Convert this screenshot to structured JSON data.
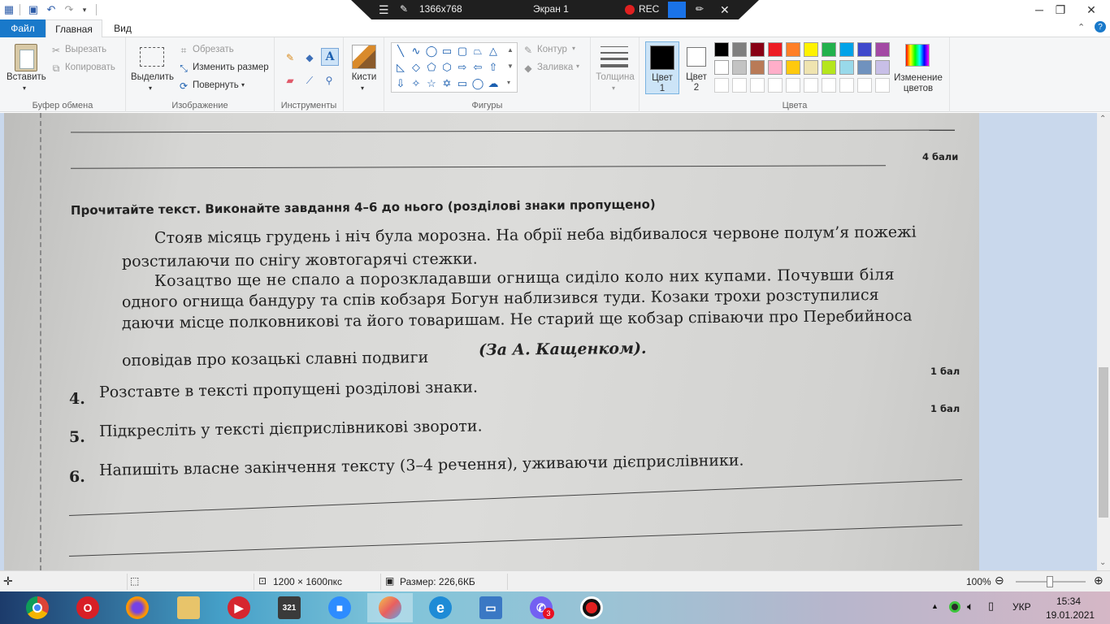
{
  "titlebar": {
    "recorder": {
      "resolution": "1366x768",
      "screen": "Экран 1",
      "rec": "REC"
    }
  },
  "menu": {
    "file": "Файл",
    "home": "Главная",
    "view": "Вид"
  },
  "ribbon": {
    "clipboard": {
      "paste": "Вставить",
      "cut": "Вырезать",
      "copy": "Копировать",
      "label": "Буфер обмена"
    },
    "image": {
      "select": "Выделить",
      "crop": "Обрезать",
      "resize": "Изменить размер",
      "rotate": "Повернуть",
      "label": "Изображение"
    },
    "tools": {
      "label": "Инструменты"
    },
    "brushes": {
      "label": "Кисти"
    },
    "shapes": {
      "outline": "Контур",
      "fill": "Заливка",
      "label": "Фигуры"
    },
    "size": {
      "label": "Толщина"
    },
    "colors": {
      "color1_line1": "Цвет",
      "color1_line2": "1",
      "color2_line1": "Цвет",
      "color2_line2": "2",
      "edit_line1": "Изменение",
      "edit_line2": "цветов",
      "label": "Цвета",
      "palette_row1": [
        "#000000",
        "#7f7f7f",
        "#880015",
        "#ed1c24",
        "#ff7f27",
        "#fff200",
        "#22b14c",
        "#00a2e8",
        "#3f48cc",
        "#a349a4"
      ],
      "palette_row2": [
        "#ffffff",
        "#c3c3c3",
        "#b97a57",
        "#ffaec9",
        "#ffc90e",
        "#efe4b0",
        "#b5e61d",
        "#99d9ea",
        "#7092be",
        "#c8bfe7"
      ]
    }
  },
  "document": {
    "points4": "4 бали",
    "heading": "Прочитайте текст. Виконайте завдання 4–6 до нього (розділові знаки пропущено)",
    "lines": [
      "Стояв місяць грудень і ніч була морозна. На обрії неба відбивалося червоне полум’я пожежі",
      "розстилаючи по снігу жовтогарячі стежки.",
      "Козацтво ще не спало а порозкладавши огнища сиділо коло них купами. Почувши біля",
      "одного огнища бандуру та спів кобзаря Богун наблизився туди. Козаки трохи розступилися",
      "даючи місце полковникові та його товаришам. Не старий ще кобзар співаючи про Перебийноса",
      "оповідав про козацькі славні подвиги"
    ],
    "attribution": "(За А. Кащенком).",
    "points1a": "1 бал",
    "points1b": "1 бал",
    "tasks": [
      {
        "num": "4.",
        "text": "Розставте в тексті пропущені розділові знаки."
      },
      {
        "num": "5.",
        "text": "Підкресліть у тексті дієприслівникові звороти."
      },
      {
        "num": "6.",
        "text": "Напишіть власне закінчення тексту (3–4 речення), уживаючи дієприслівники."
      }
    ]
  },
  "statusbar": {
    "dimensions": "1200 × 1600пкс",
    "size": "Размер: 226,6КБ",
    "zoom": "100%"
  },
  "taskbar": {
    "viber_badge": "3",
    "lang": "УКР",
    "time": "15:34",
    "date": "19.01.2021"
  }
}
